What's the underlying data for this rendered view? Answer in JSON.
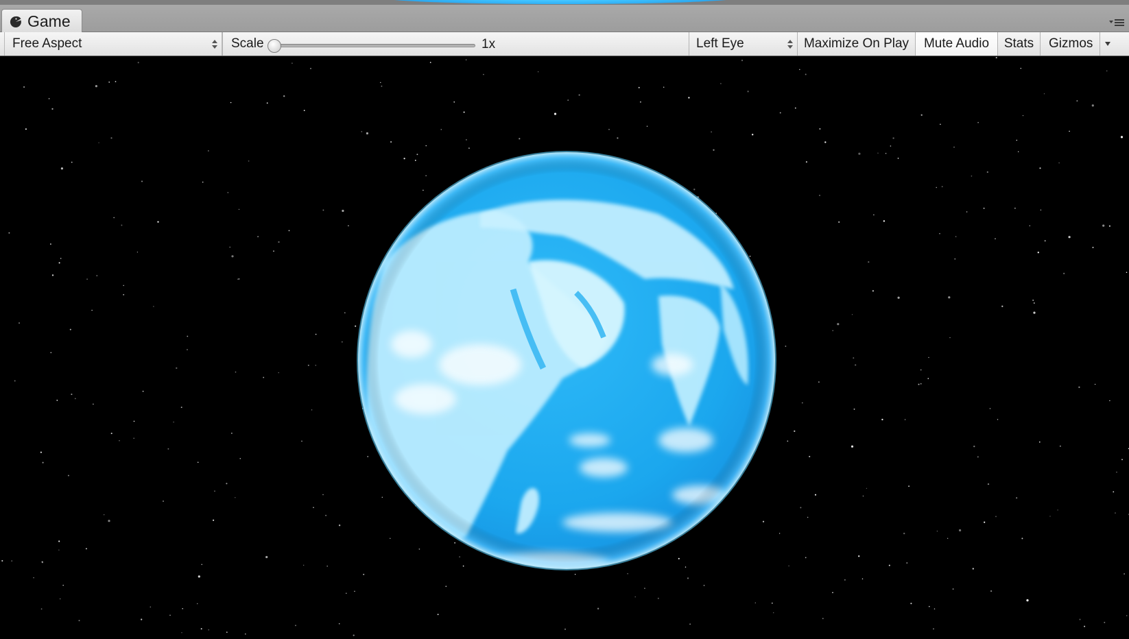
{
  "window": {
    "tab_label": "Game",
    "tab_icon": "pacman-game-icon"
  },
  "toolbar": {
    "aspect": "Free Aspect",
    "scale_label": "Scale",
    "scale_value": "1x",
    "eye": "Left Eye",
    "maximize_on_play": "Maximize On Play",
    "mute_audio": "Mute Audio",
    "stats": "Stats",
    "gizmos": "Gizmos"
  },
  "colors": {
    "space_background": "#000000",
    "planet_blue": "#2fb6f5",
    "planet_land": "#c8f2ff",
    "toggled_button": "#ffffff"
  }
}
